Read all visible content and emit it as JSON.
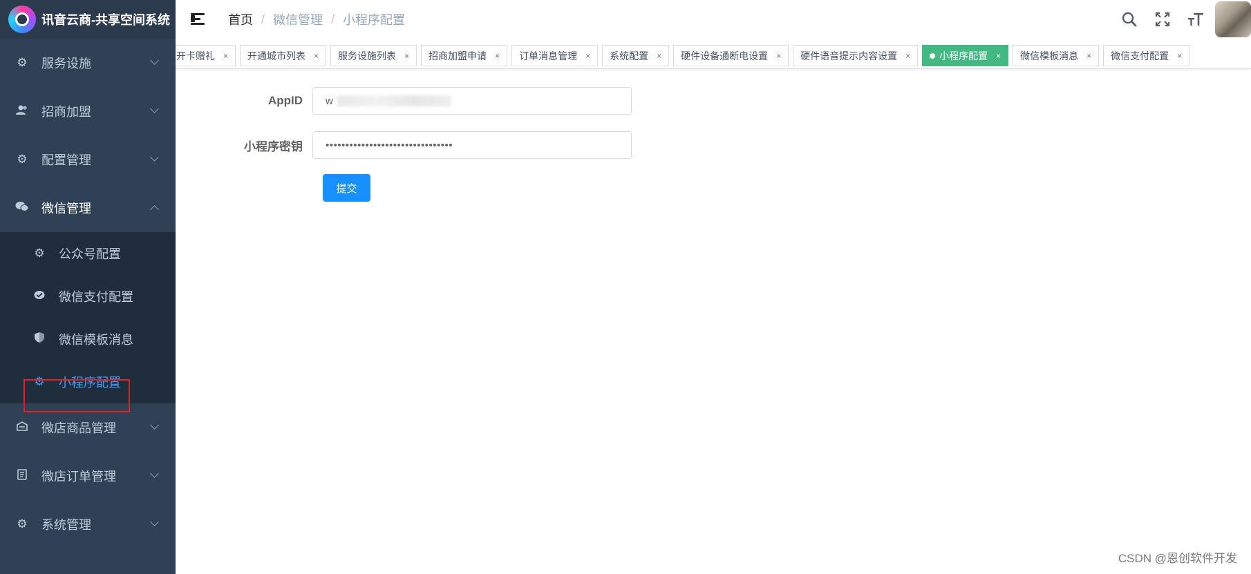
{
  "sidebar": {
    "logo_title": "讯音云商-共享空间系统",
    "menu": [
      {
        "label": "服务设施",
        "icon": "gear-icon"
      },
      {
        "label": "招商加盟",
        "icon": "users-icon"
      },
      {
        "label": "配置管理",
        "icon": "gear-icon"
      },
      {
        "label": "微信管理",
        "icon": "wechat-icon",
        "open": true,
        "children": [
          {
            "label": "公众号配置",
            "icon": "gear-icon"
          },
          {
            "label": "微信支付配置",
            "icon": "wechat-pay-icon"
          },
          {
            "label": "微信模板消息",
            "icon": "shield-icon"
          },
          {
            "label": "小程序配置",
            "icon": "gear-icon",
            "active": true
          }
        ]
      },
      {
        "label": "微店商品管理",
        "icon": "shop-icon"
      },
      {
        "label": "微店订单管理",
        "icon": "order-icon"
      },
      {
        "label": "系统管理",
        "icon": "gear-icon"
      }
    ]
  },
  "navbar": {
    "breadcrumb": [
      "首页",
      "微信管理",
      "小程序配置"
    ]
  },
  "tags": [
    {
      "label": "开卡赠礼"
    },
    {
      "label": "开通城市列表"
    },
    {
      "label": "服务设施列表"
    },
    {
      "label": "招商加盟申请"
    },
    {
      "label": "订单消息管理"
    },
    {
      "label": "系统配置"
    },
    {
      "label": "硬件设备通断电设置"
    },
    {
      "label": "硬件语音提示内容设置"
    },
    {
      "label": "小程序配置",
      "active": true
    },
    {
      "label": "微信模板消息"
    },
    {
      "label": "微信支付配置"
    }
  ],
  "tag_close": "×",
  "form": {
    "appid_label": "AppID",
    "appid_value": "w",
    "secret_label": "小程序密钥",
    "secret_value": "••••••••••••••••••••••••••••••••",
    "submit_label": "提交"
  },
  "watermark": "CSDN @恩创软件开发",
  "colors": {
    "sidebar_bg": "#304156",
    "active_menu": "#409eff",
    "active_tag": "#42b983",
    "primary_button": "#1890ff",
    "highlight_border": "#e02424"
  }
}
